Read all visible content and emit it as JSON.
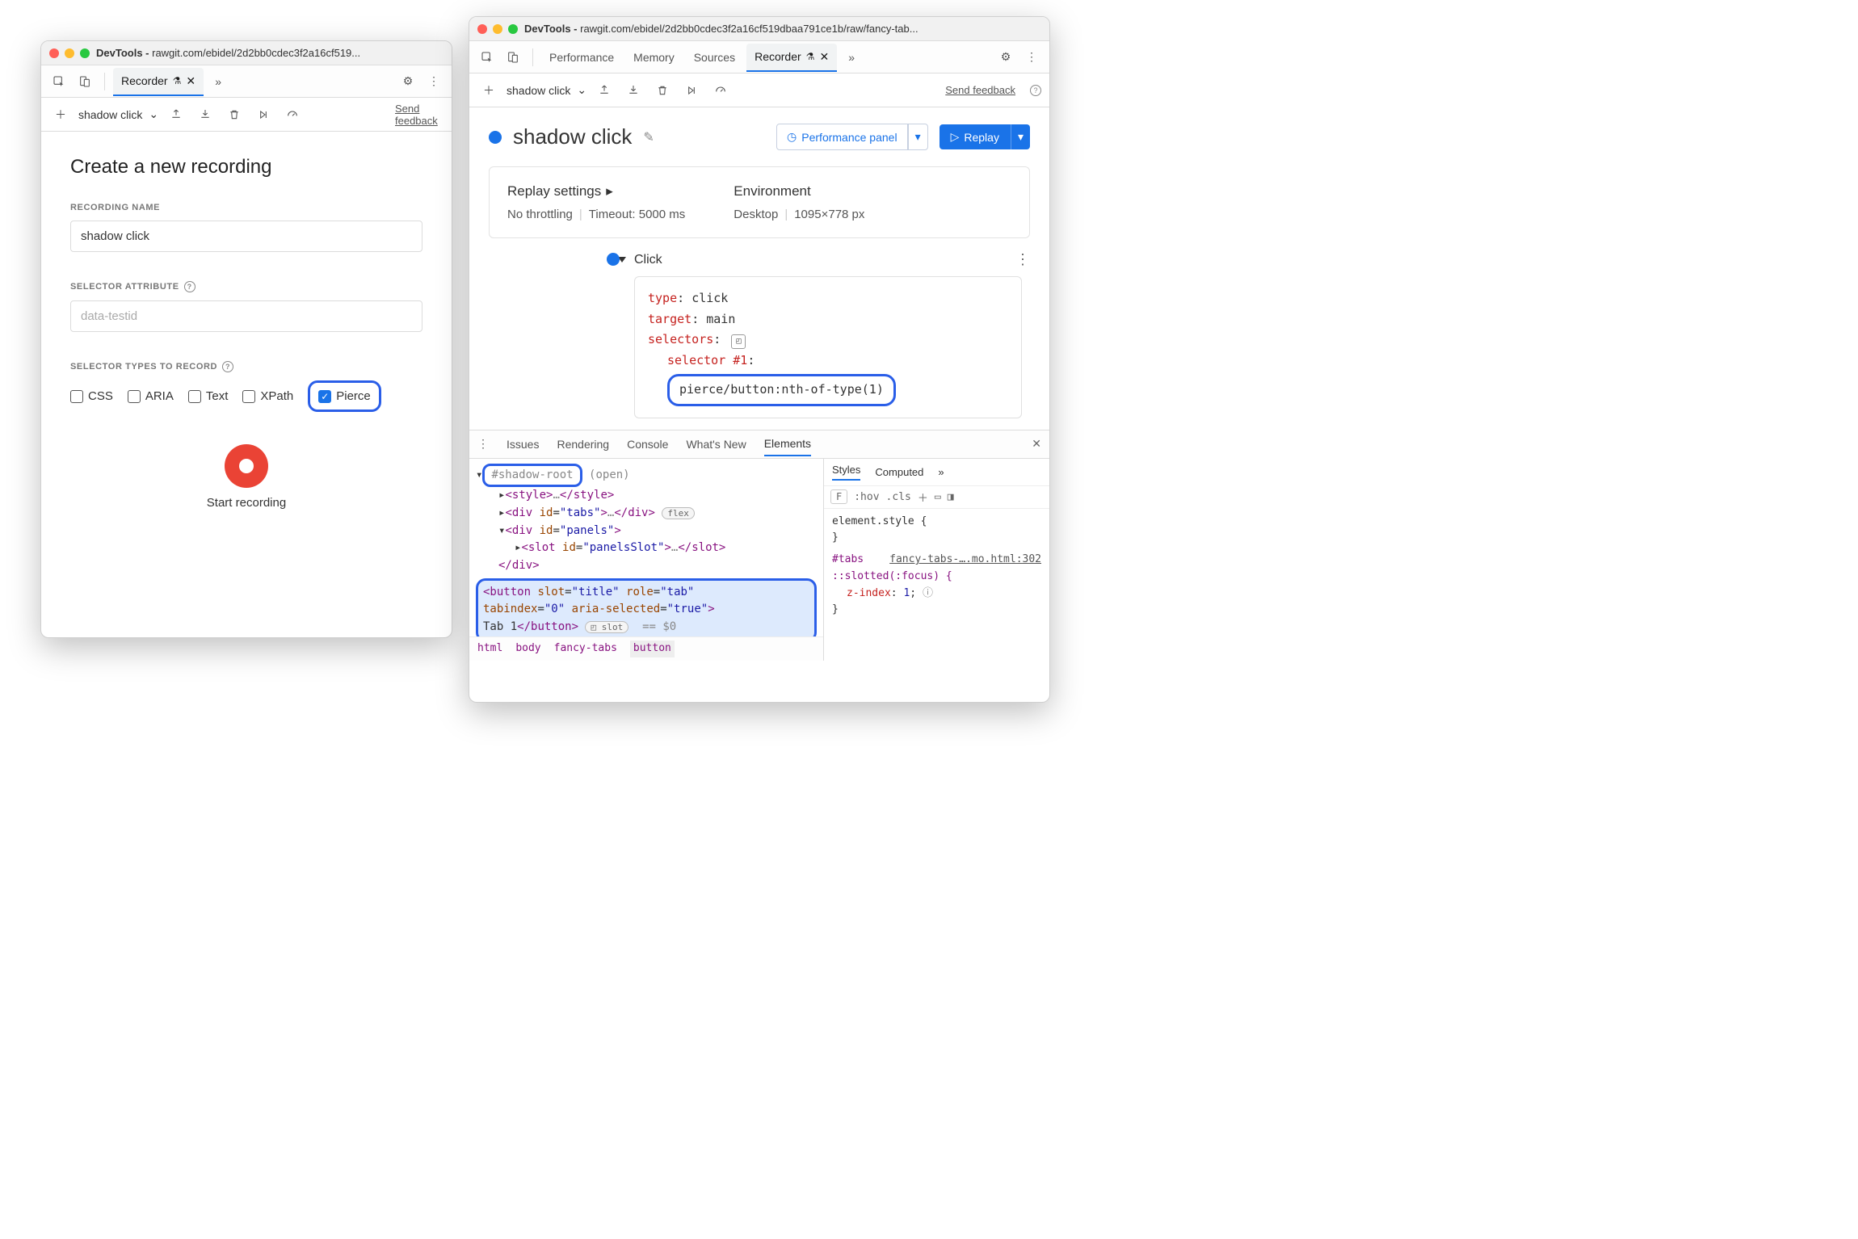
{
  "left": {
    "title_prefix": "DevTools - ",
    "title_url": "rawgit.com/ebidel/2d2bb0cdec3f2a16cf519...",
    "tab_name": "Recorder",
    "toolbar": {
      "recording_name": "shadow click",
      "send_feedback": "Send feedback"
    },
    "heading": "Create a new recording",
    "labels": {
      "recording_name": "RECORDING NAME",
      "selector_attribute": "SELECTOR ATTRIBUTE",
      "selector_types": "SELECTOR TYPES TO RECORD"
    },
    "recording_name_value": "shadow click",
    "selector_attribute_placeholder": "data-testid",
    "selector_types": [
      {
        "label": "CSS",
        "checked": false
      },
      {
        "label": "ARIA",
        "checked": false
      },
      {
        "label": "Text",
        "checked": false
      },
      {
        "label": "XPath",
        "checked": false
      },
      {
        "label": "Pierce",
        "checked": true
      }
    ],
    "start_recording": "Start recording"
  },
  "right": {
    "title_prefix": "DevTools - ",
    "title_url": "rawgit.com/ebidel/2d2bb0cdec3f2a16cf519dbaa791ce1b/raw/fancy-tab...",
    "tabs": [
      "Performance",
      "Memory",
      "Sources",
      "Recorder"
    ],
    "active_tab": "Recorder",
    "toolbar": {
      "recording_name": "shadow click",
      "send_feedback": "Send feedback"
    },
    "header": {
      "title": "shadow click",
      "perf_panel": "Performance panel",
      "replay": "Replay"
    },
    "settings": {
      "replay_settings": "Replay settings",
      "throttling": "No throttling",
      "timeout": "Timeout: 5000 ms",
      "environment": "Environment",
      "env_device": "Desktop",
      "env_viewport": "1095×778 px"
    },
    "step": {
      "name": "Click",
      "kv": {
        "type_k": "type",
        "type_v": "click",
        "target_k": "target",
        "target_v": "main",
        "selectors_k": "selectors",
        "selector1_k": "selector #1",
        "selector1_v": "pierce/button:nth-of-type(1)"
      }
    },
    "drawer_tabs": [
      "Issues",
      "Rendering",
      "Console",
      "What's New",
      "Elements"
    ],
    "drawer_active": "Elements",
    "elements": {
      "shadow_root": "#shadow-root",
      "open": "(open)",
      "style_tag": "<style>…</style>",
      "tabs_div_open": "<div id=\"tabs\">",
      "flex_badge": "flex",
      "panels_open": "<div id=\"panels\">",
      "slot_line": "<slot id=\"panelsSlot\">…</slot>",
      "div_close": "</div>",
      "button_line1": "<button slot=\"title\" role=\"tab\"",
      "button_line2": "tabindex=\"0\" aria-selected=\"true\">",
      "button_line3_text": "Tab 1",
      "button_line3_close": "</button>",
      "slot_badge": "slot",
      "eq0": "== $0",
      "breadcrumbs": [
        "html",
        "body",
        "fancy-tabs",
        "button"
      ]
    },
    "styles": {
      "tabs": [
        "Styles",
        "Computed"
      ],
      "filter": "F",
      "hov": ":hov",
      "cls": ".cls",
      "element_style": "element.style {",
      "close_brace": "}",
      "selector": "#tabs",
      "source": "fancy-tabs-….mo.html:302",
      "slotted": "::slotted(:focus) {",
      "prop": "z-index",
      "val": "1"
    }
  }
}
